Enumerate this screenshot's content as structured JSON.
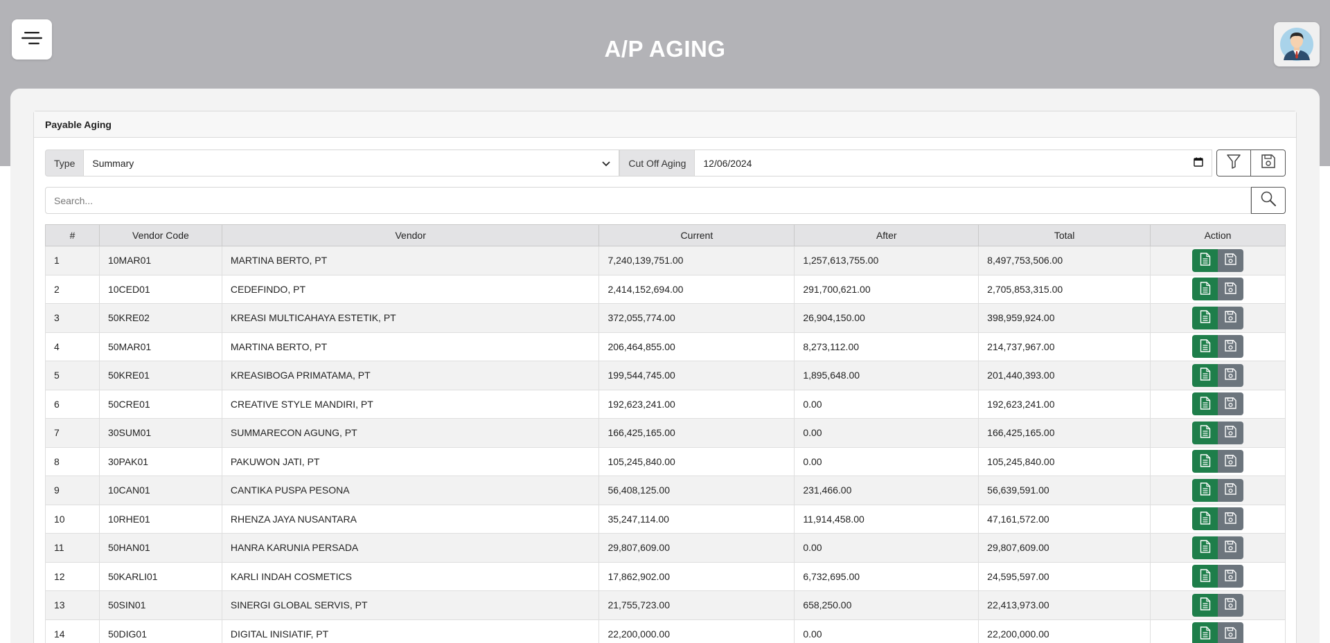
{
  "header": {
    "title": "A/P AGING"
  },
  "panel": {
    "title": "Payable Aging"
  },
  "filters": {
    "type_label": "Type",
    "type_value": "Summary",
    "cutoff_label": "Cut Off Aging",
    "cutoff_value": "12/06/2024"
  },
  "search": {
    "placeholder": "Search..."
  },
  "table": {
    "columns": [
      "#",
      "Vendor Code",
      "Vendor",
      "Current",
      "After",
      "Total",
      "Action"
    ],
    "rows": [
      {
        "no": "1",
        "code": "10MAR01",
        "vendor": "MARTINA BERTO, PT",
        "current": "7,240,139,751.00",
        "after": "1,257,613,755.00",
        "total": "8,497,753,506.00"
      },
      {
        "no": "2",
        "code": "10CED01",
        "vendor": "CEDEFINDO, PT",
        "current": "2,414,152,694.00",
        "after": "291,700,621.00",
        "total": "2,705,853,315.00"
      },
      {
        "no": "3",
        "code": "50KRE02",
        "vendor": "KREASI MULTICAHAYA ESTETIK, PT",
        "current": "372,055,774.00",
        "after": "26,904,150.00",
        "total": "398,959,924.00"
      },
      {
        "no": "4",
        "code": "50MAR01",
        "vendor": "MARTINA BERTO, PT",
        "current": "206,464,855.00",
        "after": "8,273,112.00",
        "total": "214,737,967.00"
      },
      {
        "no": "5",
        "code": "50KRE01",
        "vendor": "KREASIBOGA PRIMATAMA, PT",
        "current": "199,544,745.00",
        "after": "1,895,648.00",
        "total": "201,440,393.00"
      },
      {
        "no": "6",
        "code": "50CRE01",
        "vendor": "CREATIVE STYLE MANDIRI, PT",
        "current": "192,623,241.00",
        "after": "0.00",
        "total": "192,623,241.00"
      },
      {
        "no": "7",
        "code": "30SUM01",
        "vendor": "SUMMARECON AGUNG, PT",
        "current": "166,425,165.00",
        "after": "0.00",
        "total": "166,425,165.00"
      },
      {
        "no": "8",
        "code": "30PAK01",
        "vendor": "PAKUWON JATI, PT",
        "current": "105,245,840.00",
        "after": "0.00",
        "total": "105,245,840.00"
      },
      {
        "no": "9",
        "code": "10CAN01",
        "vendor": "CANTIKA PUSPA PESONA",
        "current": "56,408,125.00",
        "after": "231,466.00",
        "total": "56,639,591.00"
      },
      {
        "no": "10",
        "code": "10RHE01",
        "vendor": "RHENZA JAYA NUSANTARA",
        "current": "35,247,114.00",
        "after": "11,914,458.00",
        "total": "47,161,572.00"
      },
      {
        "no": "11",
        "code": "50HAN01",
        "vendor": "HANRA KARUNIA PERSADA",
        "current": "29,807,609.00",
        "after": "0.00",
        "total": "29,807,609.00"
      },
      {
        "no": "12",
        "code": "50KARLI01",
        "vendor": "KARLI INDAH COSMETICS",
        "current": "17,862,902.00",
        "after": "6,732,695.00",
        "total": "24,595,597.00"
      },
      {
        "no": "13",
        "code": "50SIN01",
        "vendor": "SINERGI GLOBAL SERVIS, PT",
        "current": "21,755,723.00",
        "after": "658,250.00",
        "total": "22,413,973.00"
      },
      {
        "no": "14",
        "code": "50DIG01",
        "vendor": "DIGITAL INISIATIF, PT",
        "current": "22,200,000.00",
        "after": "0.00",
        "total": "22,200,000.00"
      }
    ]
  },
  "icons": {
    "menu": "hamburger-icon",
    "avatar": "user-avatar",
    "filter": "filter-icon",
    "save": "floppy-disk-icon",
    "search": "search-icon",
    "document": "document-icon",
    "calendar": "calendar-icon",
    "dropdown": "chevron-down-icon"
  },
  "colors": {
    "header_band": "#b3b3b7",
    "doc_button": "#1e7e4a",
    "save_button": "#6c757d"
  }
}
